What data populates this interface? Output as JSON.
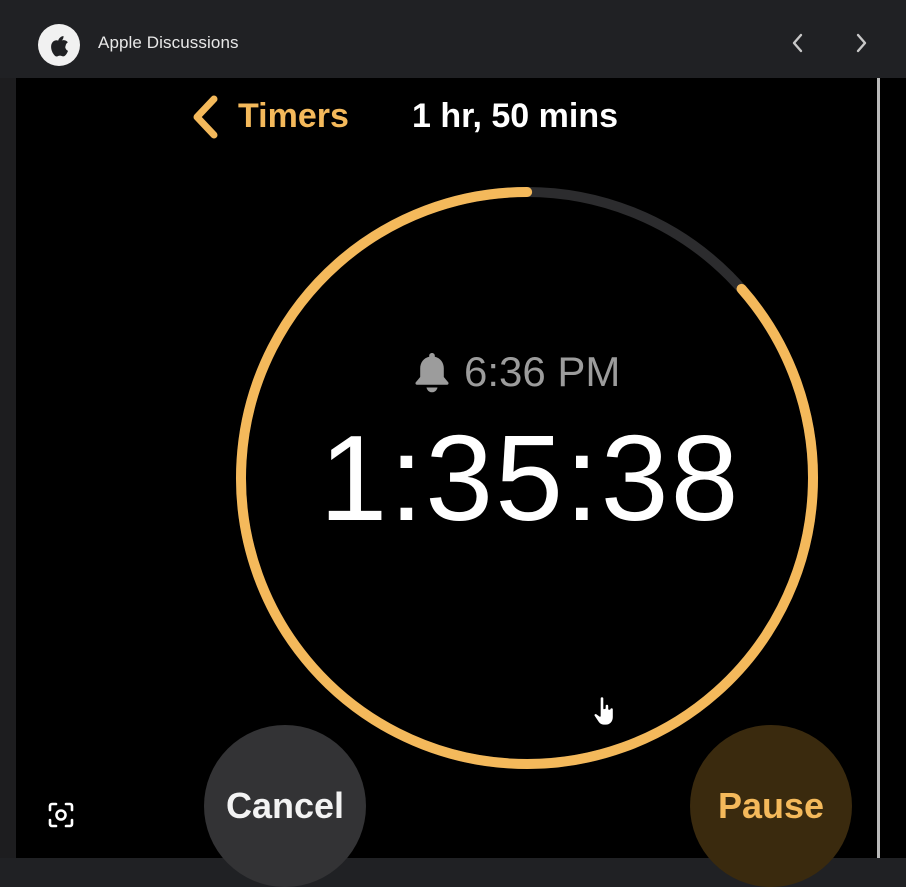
{
  "browser": {
    "site_title": "Apple Discussions",
    "logo_icon": "apple-logo-icon",
    "nav_prev_icon": "chevron-left-icon",
    "nav_next_icon": "chevron-right-icon"
  },
  "timer": {
    "back_label": "Timers",
    "back_icon": "chevron-left-icon",
    "duration_label": "1 hr, 50 mins",
    "alarm_icon": "bell-icon",
    "alarm_time": "6:36 PM",
    "countdown": "1:35:38",
    "progress_remaining_fraction": 0.865,
    "cancel_label": "Cancel",
    "pause_label": "Pause"
  },
  "colors": {
    "accent": "#f4b95b",
    "ring_track": "#2c2c2e",
    "background": "#000000",
    "chrome": "#202124"
  },
  "tools": {
    "screenshot_icon": "screenshot-tool-icon",
    "cursor_icon": "hand-pointer-icon"
  }
}
